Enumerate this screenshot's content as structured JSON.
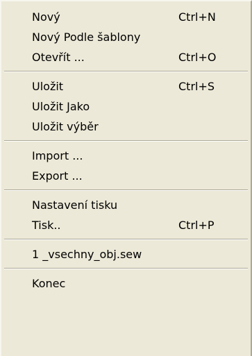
{
  "menu": {
    "groups": [
      [
        {
          "label": "Nový",
          "shortcut": "Ctrl+N"
        },
        {
          "label": "Nový Podle šablony",
          "shortcut": ""
        },
        {
          "label": "Otevřít ...",
          "shortcut": "Ctrl+O"
        }
      ],
      [
        {
          "label": "Uložit",
          "shortcut": "Ctrl+S"
        },
        {
          "label": "Uložit Jako",
          "shortcut": ""
        },
        {
          "label": "Uložit výběr",
          "shortcut": ""
        }
      ],
      [
        {
          "label": "Import ...",
          "shortcut": ""
        },
        {
          "label": "Export ...",
          "shortcut": ""
        }
      ],
      [
        {
          "label": "Nastavení tisku",
          "shortcut": ""
        },
        {
          "label": "Tisk..",
          "shortcut": "Ctrl+P"
        }
      ],
      [
        {
          "label": "1 _vsechny_obj.sew",
          "shortcut": ""
        }
      ],
      [
        {
          "label": "Konec",
          "shortcut": ""
        }
      ]
    ]
  }
}
